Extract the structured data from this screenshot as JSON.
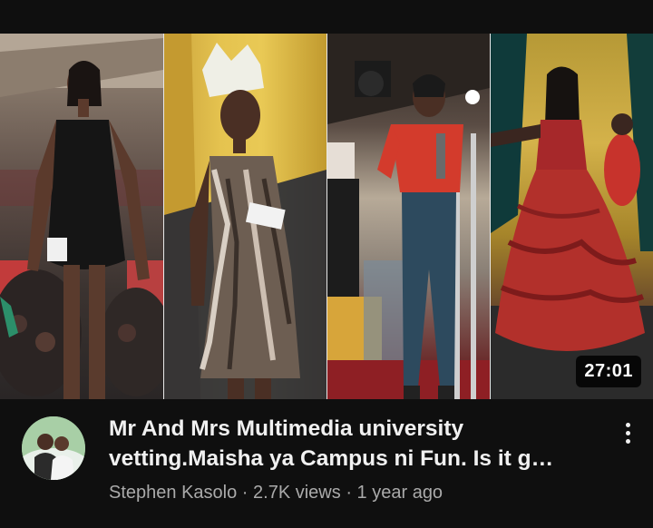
{
  "video": {
    "duration": "27:01",
    "title": "Mr And Mrs Multimedia university\nvetting.Maisha ya Campus ni Fun. Is it g…",
    "channel": "Stephen Kasolo",
    "separator": "·",
    "views": "2.7K views",
    "age": "1 year ago"
  },
  "icons": {
    "more": "more-vert-icon",
    "avatar": "channel-avatar"
  },
  "colors": {
    "background": "#0f0f0f",
    "title_text": "#f1f1f1",
    "meta_text": "#aaaaaa",
    "duration_bg": "#000000"
  }
}
